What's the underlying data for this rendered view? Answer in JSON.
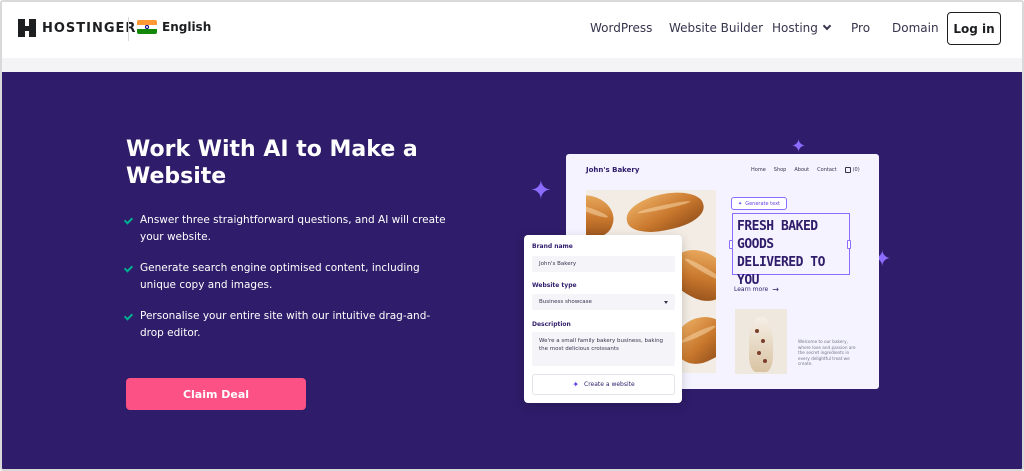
{
  "header": {
    "logo_text": "HOSTINGER",
    "language": "English",
    "nav": {
      "wordpress": "WordPress",
      "website_builder": "Website Builder",
      "hosting": "Hosting",
      "pro": "Pro",
      "domain": "Domain"
    },
    "login_label": "Log in"
  },
  "hero": {
    "title": "Work With AI to Make a Website",
    "features": [
      "Answer three straightforward questions, and AI will create your website.",
      "Generate search engine optimised content, including unique copy and images.",
      "Personalise your entire site with our intuitive drag-and-drop editor."
    ],
    "cta_label": "Claim Deal"
  },
  "mockup": {
    "site": {
      "brand": "John's Bakery",
      "nav": [
        "Home",
        "Shop",
        "About",
        "Contact"
      ],
      "cart_count": "(0)",
      "generate_chip": "Generate text",
      "headline": "FRESH BAKED GOODS DELIVERED TO YOU",
      "learn_more": "Learn more",
      "about_text": "Welcome to our bakery, where love and passion are the secret ingredients in every delightful treat we create."
    },
    "form": {
      "brand_name_label": "Brand name",
      "brand_name_value": "John's Bakery",
      "website_type_label": "Website type",
      "website_type_value": "Business showcase",
      "description_label": "Description",
      "description_value": "We're a small family bakery business, baking the most delicious croissants",
      "button_label": "Create a website"
    }
  },
  "colors": {
    "hero_bg": "#2f1c6a",
    "cta": "#fc5185",
    "accent": "#8c6cff",
    "check": "#00b090"
  }
}
